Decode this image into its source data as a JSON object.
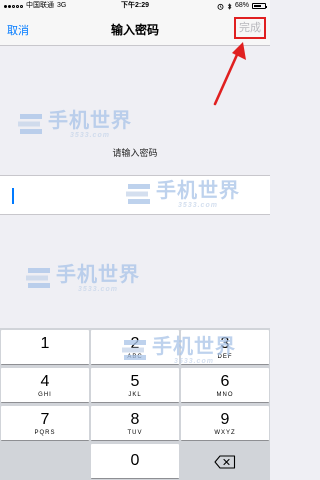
{
  "status": {
    "carrier": "中国联通",
    "network": "3G",
    "time": "下午2:29",
    "battery_text": "68%",
    "battery_level": 0.68
  },
  "nav": {
    "cancel": "取消",
    "title": "输入密码",
    "done": "完成"
  },
  "prompt": "请输入密码",
  "watermark": {
    "title": "手机世界",
    "url": "3533.com"
  },
  "keypad": {
    "keys": [
      {
        "digit": "1",
        "letters": ""
      },
      {
        "digit": "2",
        "letters": "ABC"
      },
      {
        "digit": "3",
        "letters": "DEF"
      },
      {
        "digit": "4",
        "letters": "GHI"
      },
      {
        "digit": "5",
        "letters": "JKL"
      },
      {
        "digit": "6",
        "letters": "MNO"
      },
      {
        "digit": "7",
        "letters": "PQRS"
      },
      {
        "digit": "8",
        "letters": "TUV"
      },
      {
        "digit": "9",
        "letters": "WXYZ"
      },
      {
        "digit": "0",
        "letters": ""
      }
    ],
    "backspace_icon": "backspace-icon"
  },
  "colors": {
    "accent": "#007aff",
    "annotation": "#e02020",
    "disabled": "#b8b8bd"
  }
}
